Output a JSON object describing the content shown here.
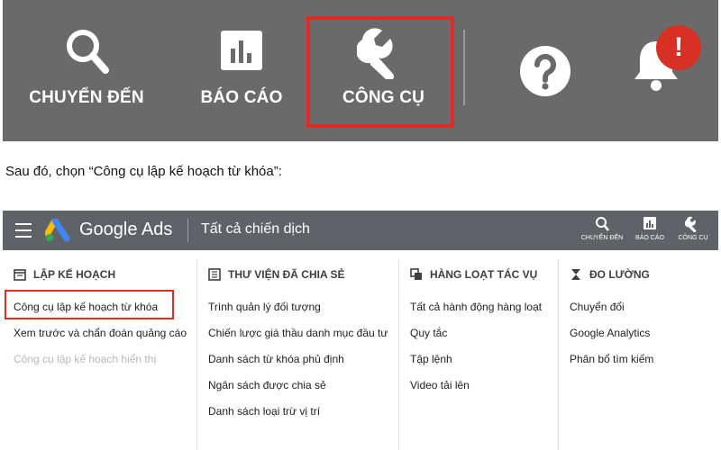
{
  "toolbar": {
    "goto_label": "CHUYỂN ĐẾN",
    "reports_label": "BÁO CÁO",
    "tools_label": "CÔNG CỤ",
    "alert_badge": "!",
    "icons": [
      "search-icon",
      "bar-chart-icon",
      "wrench-icon",
      "help-icon",
      "bell-icon"
    ]
  },
  "instruction": "Sau đó, chọn “Công cụ lập kế hoạch từ khóa”:",
  "ads_header": {
    "brand": "Google Ads",
    "campaign_label": "Tất cả chiến dịch",
    "tools": [
      {
        "label": "CHUYỂN ĐẾN",
        "icon": "search-icon"
      },
      {
        "label": "BÁO CÁO",
        "icon": "bar-chart-icon"
      },
      {
        "label": "CÔNG CỤ",
        "icon": "wrench-icon"
      }
    ]
  },
  "menu": {
    "columns": [
      {
        "heading": "LẬP KẾ HOẠCH",
        "icon": "calendar-icon",
        "items": [
          "Công cụ lập kế hoạch từ khóa",
          "Xem trước và chẩn đoán quảng cáo",
          "Công cụ lập kế hoạch hiển thị"
        ]
      },
      {
        "heading": "THƯ VIỆN ĐÃ CHIA SẺ",
        "icon": "library-icon",
        "items": [
          "Trình quản lý đối tượng",
          "Chiến lược giá thầu danh mục đầu tư",
          "Danh sách từ khóa phủ định",
          "Ngân sách được chia sẻ",
          "Danh sách loại trừ vị trí"
        ]
      },
      {
        "heading": "HÀNG LOẠT TÁC VỤ",
        "icon": "copy-icon",
        "items": [
          "Tất cả hành động hàng loạt",
          "Quy tắc",
          "Tập lệnh",
          "Video tải lên"
        ]
      },
      {
        "heading": "ĐO LƯỜNG",
        "icon": "hourglass-icon",
        "items": [
          "Chuyển đổi",
          "Google Analytics",
          "Phân bổ tìm kiếm"
        ]
      }
    ]
  },
  "colors": {
    "toolbar_bg": "#6a6a6a",
    "header_bg": "#5f6368",
    "highlight": "#e02d24",
    "alert": "#d93025",
    "disabled_text": "#b8b8b8"
  }
}
